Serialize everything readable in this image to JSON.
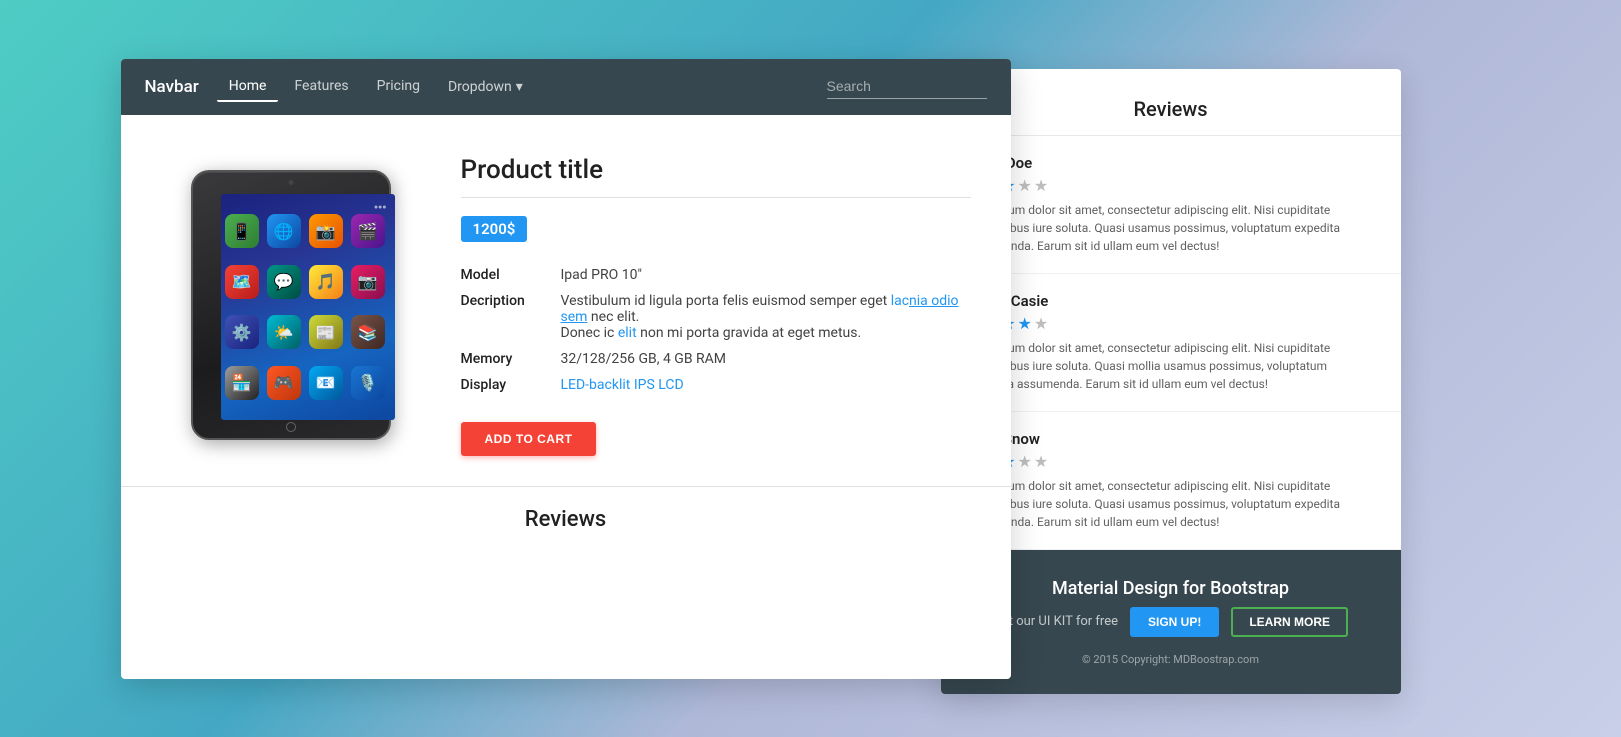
{
  "navbar": {
    "brand": "Navbar",
    "links": [
      {
        "label": "Home",
        "active": true
      },
      {
        "label": "Features",
        "active": false
      },
      {
        "label": "Pricing",
        "active": false
      },
      {
        "label": "Dropdown",
        "active": false,
        "hasDropdown": true
      }
    ],
    "search_placeholder": "Search"
  },
  "product": {
    "title": "Product title",
    "price": "1200$",
    "specs": [
      {
        "label": "Model",
        "value": "Ipad PRO 10\"",
        "hasLink": false
      },
      {
        "label": "Decription",
        "value_parts": [
          {
            "text": "Vestibulum id ligula porta felis euismod semper eget lac",
            "link": false
          },
          {
            "text": "nia odio sem",
            "link": true
          },
          {
            "text": " nec elit.",
            "link": false
          },
          {
            "text": "\nDonec id ",
            "link": false
          },
          {
            "text": "elit",
            "link": true
          },
          {
            "text": " non mi porta gravida at eget metus.",
            "link": false
          }
        ],
        "value": "Vestibulum id ligula porta felis euismod semper eget lacnia odio sem nec elit.\nDonec id elit non mi porta gravida at eget metus."
      },
      {
        "label": "Memory",
        "value": "32/128/256 GB, 4 GB RAM",
        "hasLink": false
      },
      {
        "label": "Display",
        "value": "LED-backlit IPS LCD",
        "hasLink": true
      }
    ],
    "add_to_cart": "ADD TO CART"
  },
  "reviews_section": {
    "title": "Reviews"
  },
  "bg_card": {
    "reviews_header": "Reviews",
    "reviews": [
      {
        "name": "John Doe",
        "stars": [
          true,
          true,
          true,
          false,
          false
        ],
        "text": "rem ipsum dolor sit amet, consectetur adipiscing elit. Nisi cupiditate temporibus iure soluta. Quasi usamus possimus, voluptatum expedita assumenda. Earum sit id ullam eum vel dectus!"
      },
      {
        "name": "Maria Casie",
        "stars": [
          true,
          true,
          true,
          true,
          false
        ],
        "text": "rem ipsum dolor sit amet, consectetur adipiscing elit. Nisi cupiditate temporibus iure soluta. Quasi mollia usamus possimus, voluptatum expedita assumenda. Earum sit id ullam eum vel dectus!"
      },
      {
        "name": "Kate Snow",
        "stars": [
          true,
          true,
          true,
          false,
          false
        ],
        "text": "rem ipsum dolor sit amet, consectetur adipiscing elit. Nisi cupiditate temporibus iure soluta. Quasi usamus possimus, voluptatum expedita assumenda. Earum sit id ullam eum vel dectus!"
      }
    ],
    "footer": {
      "title": "Material Design for Bootstrap",
      "cta_text": "Get our UI KIT for free",
      "signup_label": "SIGN UP!",
      "learn_more_label": "LEARN MORE",
      "copyright": "© 2015 Copyright: MDBoostrap.com"
    }
  }
}
